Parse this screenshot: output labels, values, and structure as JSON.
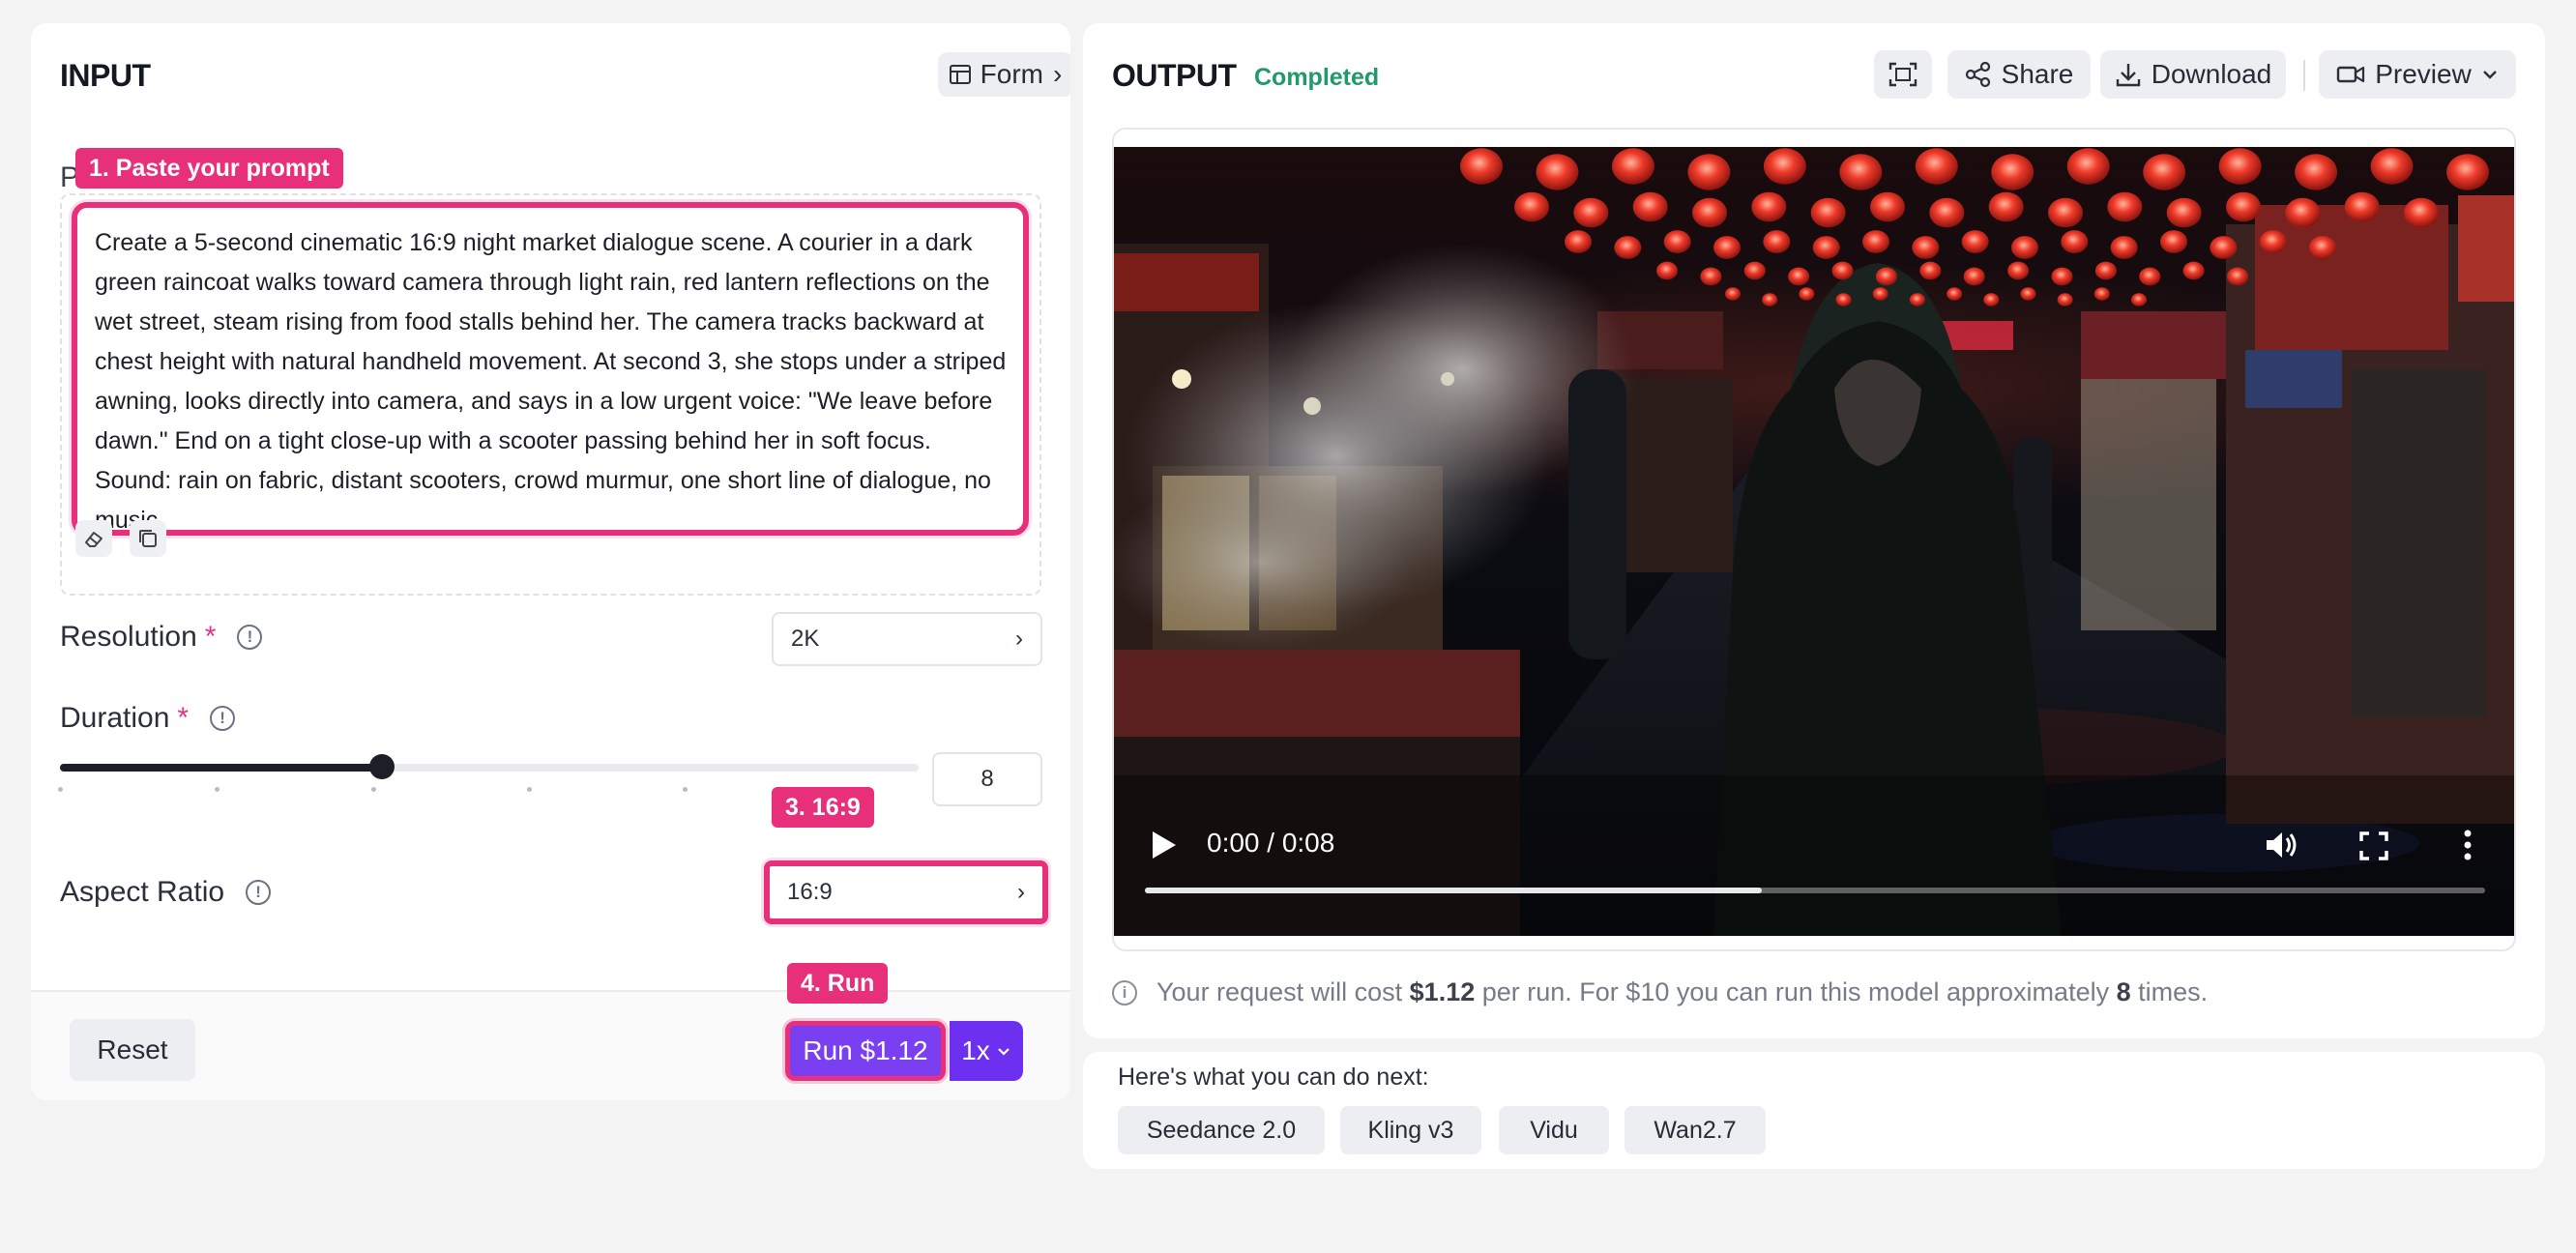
{
  "input": {
    "title": "INPUT",
    "form_button": "Form",
    "prompt_label": "P",
    "prompt_text": "Create a 5-second cinematic 16:9 night market dialogue scene. A courier in a dark green raincoat walks toward camera through light rain, red lantern reflections on the wet street, steam rising from food stalls behind her. The camera tracks backward at chest height with natural handheld movement. At second 3, she stops under a striped awning, looks directly into camera, and says in a low urgent voice: \"We leave before dawn.\" End on a tight close-up with a scooter passing behind her in soft focus. Sound: rain on fabric, distant scooters, crowd murmur, one short line of dialogue, no music.",
    "resolution": {
      "label": "Resolution",
      "required": "*",
      "value": "2K"
    },
    "duration": {
      "label": "Duration",
      "required": "*",
      "value": "8",
      "slider_fraction": 0.375
    },
    "aspect_ratio": {
      "label": "Aspect Ratio",
      "value": "16:9"
    },
    "reset_label": "Reset",
    "run_label": "Run $1.12",
    "multiplier": "1x"
  },
  "callouts": {
    "step1": "1. Paste your prompt",
    "step3": "3. 16:9",
    "step4": "4. Run"
  },
  "output": {
    "title": "OUTPUT",
    "status": "Completed",
    "share_label": "Share",
    "download_label": "Download",
    "preview_label": "Preview",
    "video_time": "0:00 / 0:08",
    "video_progress": 0.46,
    "cost": {
      "prefix": "Your request will cost",
      "amount": "$1.12",
      "mid": "per run. For $10 you can run this model approximately",
      "times": "8",
      "suffix": "times."
    }
  },
  "next": {
    "title": "Here's what you can do next:",
    "chips": [
      "Seedance 2.0",
      "Kling v3",
      "Vidu",
      "Wan2.7"
    ]
  },
  "colors": {
    "accent": "#7b3ff2",
    "highlight": "#e8307a",
    "success": "#1f9a68"
  }
}
